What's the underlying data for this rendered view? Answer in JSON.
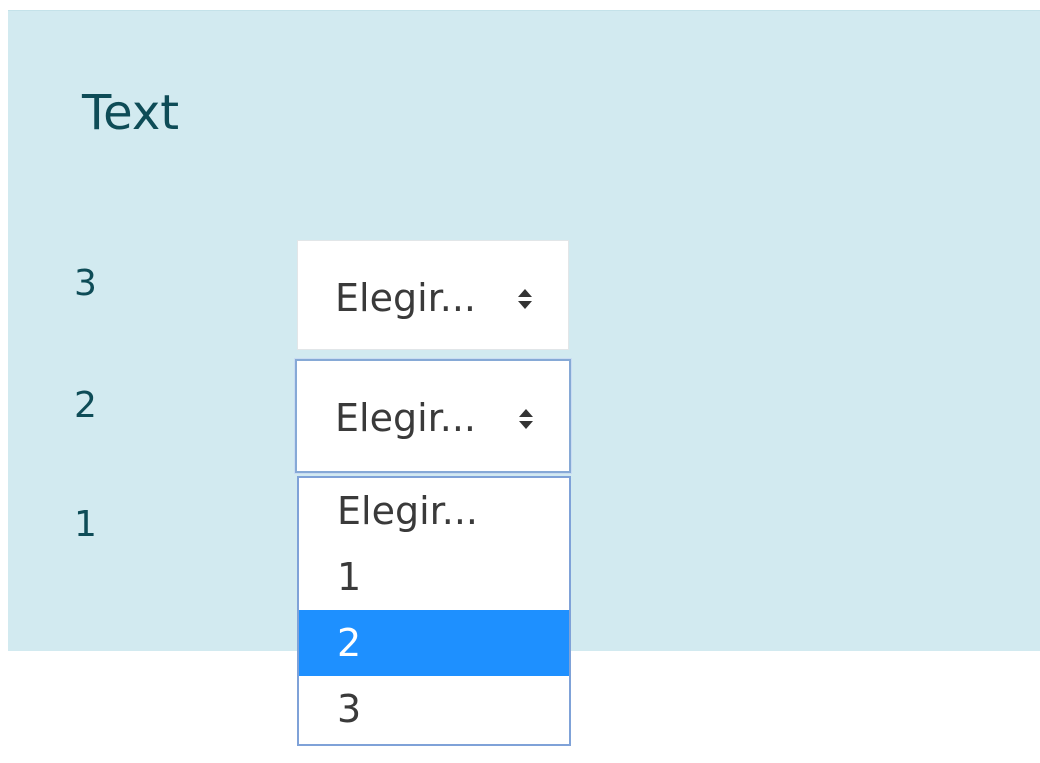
{
  "panel": {
    "title": "Text",
    "rows": [
      {
        "label": "3",
        "select_value": "Elegir..."
      },
      {
        "label": "2",
        "select_value": "Elegir..."
      },
      {
        "label": "1"
      }
    ]
  },
  "dropdown": {
    "options": [
      "Elegir...",
      "1",
      "2",
      "3"
    ],
    "highlighted_option": "2"
  },
  "colors": {
    "panel_background": "#d2eaf0",
    "text": "#0e4c57",
    "highlight": "#1e90ff",
    "focus_border": "#86a9d6"
  }
}
